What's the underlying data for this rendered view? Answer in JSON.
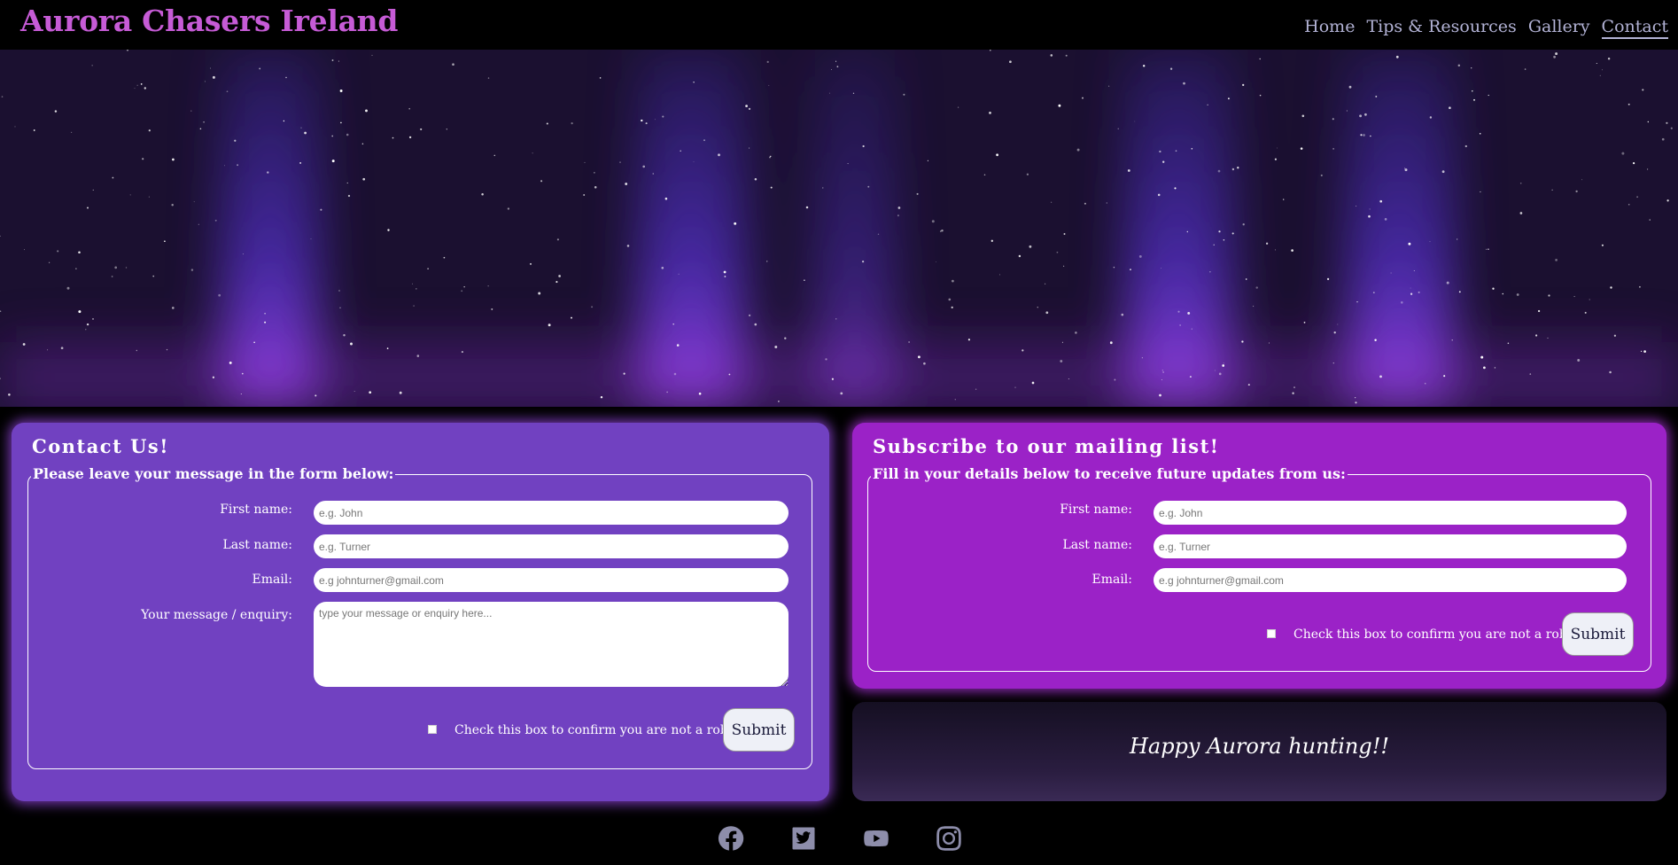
{
  "site": {
    "brand": "Aurora Chasers Ireland"
  },
  "nav": [
    {
      "label": "Home"
    },
    {
      "label": "Tips & Resources"
    },
    {
      "label": "Gallery"
    },
    {
      "label": "Contact"
    }
  ],
  "contact": {
    "title": "Contact Us!",
    "legend": "Please leave your message in the form below:",
    "first_name_label": "First name:",
    "first_name_placeholder": "e.g. John",
    "last_name_label": "Last name:",
    "last_name_placeholder": "e.g. Turner",
    "email_label": "Email:",
    "email_placeholder": "e.g johnturner@gmail.com",
    "message_label": "Your message / enquiry:",
    "message_placeholder": "type your message or enquiry here...",
    "robot_label": "Check this box to confirm you are not a robot",
    "submit_label": "Submit"
  },
  "subscribe": {
    "title": "Subscribe to our mailing list!",
    "legend": "Fill in your details below to receive future updates from us:",
    "first_name_label": "First name:",
    "first_name_placeholder": "e.g. John",
    "last_name_label": "Last name:",
    "last_name_placeholder": "e.g. Turner",
    "email_label": "Email:",
    "email_placeholder": "e.g johnturner@gmail.com",
    "robot_label": "Check this box to confirm you are not a robot",
    "submit_label": "Submit"
  },
  "footer_note": "Happy Aurora hunting!!",
  "social": [
    "facebook-icon",
    "twitter-icon",
    "youtube-icon",
    "instagram-icon"
  ],
  "colors": {
    "brand": "#c65bd6",
    "contact_panel": "#7141c1",
    "subscribe_panel": "#9b22c7",
    "nav_link": "#b3b3d6"
  }
}
